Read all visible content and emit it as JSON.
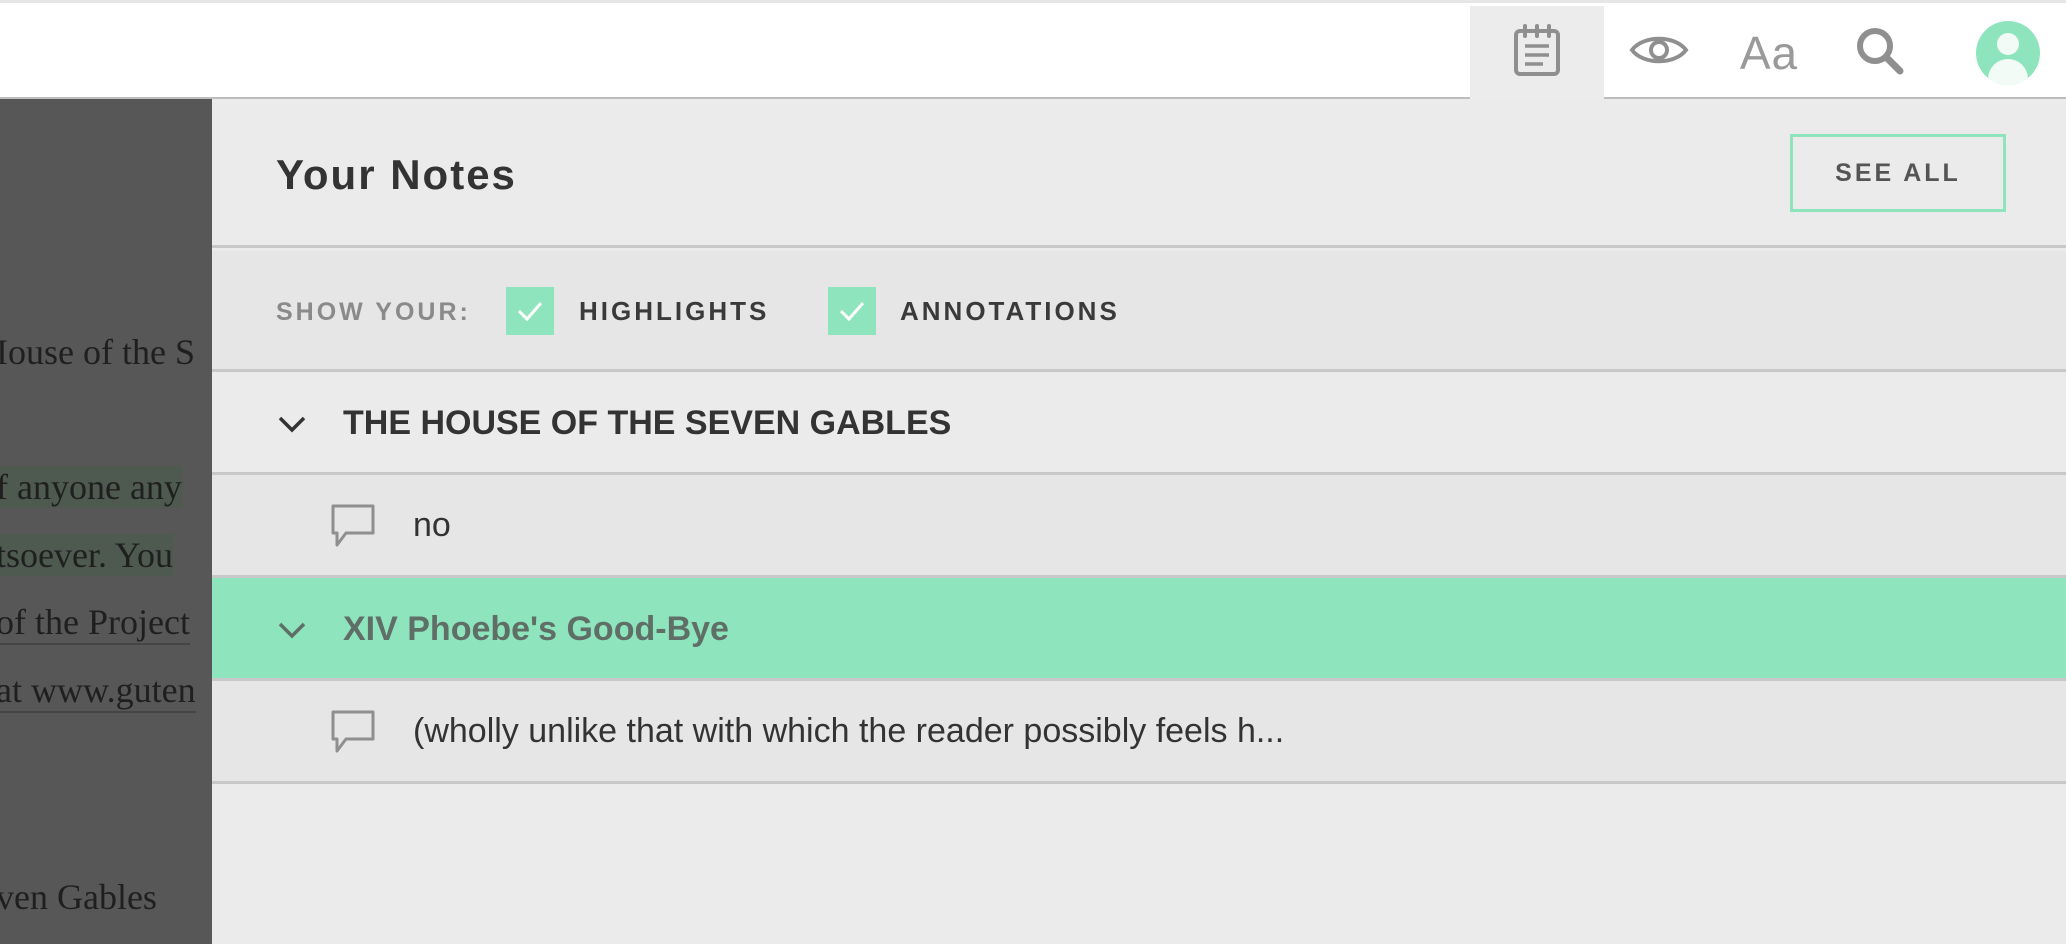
{
  "toolbar": {
    "buttons": [
      {
        "name": "notes",
        "icon": "notepad-icon",
        "active": true
      },
      {
        "name": "view",
        "icon": "eye-icon"
      },
      {
        "name": "font",
        "icon": "font-size-icon",
        "glyph": "Aa"
      },
      {
        "name": "search",
        "icon": "search-icon"
      },
      {
        "name": "account",
        "icon": "user-avatar-icon"
      }
    ]
  },
  "book_background": {
    "lines": [
      "Iouse of the S",
      "f anyone any",
      "tsoever.  You",
      "of the Project",
      "at www.guten",
      "ven Gables"
    ]
  },
  "notes_panel": {
    "title": "Your Notes",
    "see_all_label": "SEE ALL",
    "filter_label": "SHOW YOUR:",
    "filters": [
      {
        "label": "HIGHLIGHTS",
        "checked": true
      },
      {
        "label": "ANNOTATIONS",
        "checked": true
      }
    ],
    "groups": [
      {
        "title": "THE HOUSE OF THE SEVEN GABLES",
        "expanded": true,
        "selected": false,
        "notes": [
          {
            "icon": "comment-icon",
            "text": "no"
          }
        ]
      },
      {
        "title": "XIV Phoebe's Good-Bye",
        "expanded": true,
        "selected": true,
        "notes": [
          {
            "icon": "comment-icon",
            "text": "(wholly unlike that with which the reader possibly feels h..."
          }
        ]
      }
    ]
  },
  "colors": {
    "accent": "#8ee5bd",
    "panel_bg": "#ebebeb",
    "overlay": "#575757"
  }
}
